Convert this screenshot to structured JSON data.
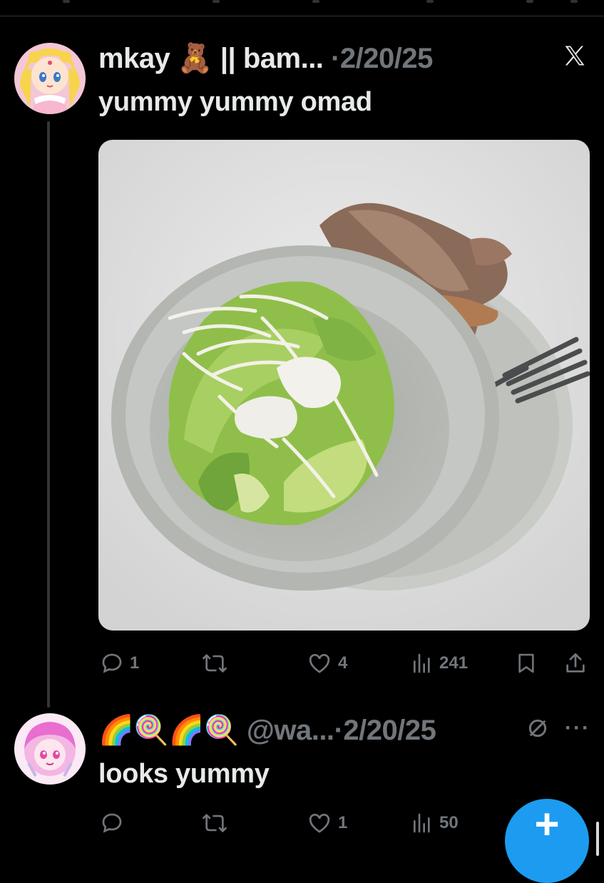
{
  "post": {
    "author_display": "mkay 🧸 || bam...",
    "separator": "·",
    "date": "2/20/25",
    "text": "yummy yummy omad",
    "actions": {
      "replies": "1",
      "retweets": "",
      "likes": "4",
      "views": "241"
    },
    "brand_icon": "x-logo-icon"
  },
  "reply": {
    "author_display": "🌈🍭🌈🍭",
    "handle": "@wa...",
    "separator": "·",
    "date": "2/20/25",
    "text": "looks yummy",
    "more_label": "···",
    "actions": {
      "replies": "",
      "retweets": "",
      "likes": "1",
      "views": "50"
    }
  },
  "fab": {
    "label": "+"
  },
  "colors": {
    "background": "#000000",
    "text": "#e7e9ea",
    "muted": "#71767b",
    "accent": "#1d9bf0",
    "thread_line": "#333639"
  }
}
